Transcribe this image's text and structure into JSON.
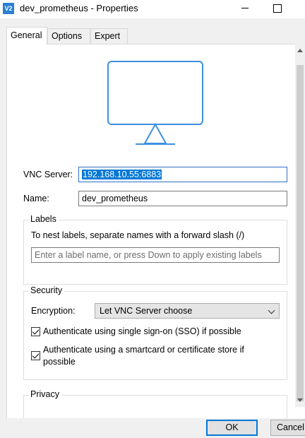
{
  "window": {
    "title": "dev_prometheus - Properties",
    "app_icon_text": "V2"
  },
  "tabs": [
    {
      "label": "General",
      "active": true
    },
    {
      "label": "Options",
      "active": false
    },
    {
      "label": "Expert",
      "active": false
    }
  ],
  "general": {
    "monitor_icon": "monitor-icon",
    "vnc_server": {
      "label": "VNC Server:",
      "value": "192.168.10.55:6883"
    },
    "name": {
      "label": "Name:",
      "value": "dev_prometheus"
    },
    "labels": {
      "title": "Labels",
      "hint": "To nest labels, separate names with a forward slash (/)",
      "placeholder": "Enter a label name, or press Down to apply existing labels"
    },
    "security": {
      "title": "Security",
      "encryption_label": "Encryption:",
      "encryption_value": "Let VNC Server choose",
      "sso_label": "Authenticate using single sign-on (SSO) if possible",
      "sso_checked": true,
      "smartcard_label_line1": "Authenticate using a smartcard or certificate store if",
      "smartcard_label_line2": "possible",
      "smartcard_checked": true
    },
    "privacy": {
      "title": "Privacy"
    }
  },
  "buttons": {
    "ok": "OK",
    "cancel": "Cancel"
  },
  "colors": {
    "accent": "#0078d7",
    "monitor": "#3d8fe0"
  }
}
